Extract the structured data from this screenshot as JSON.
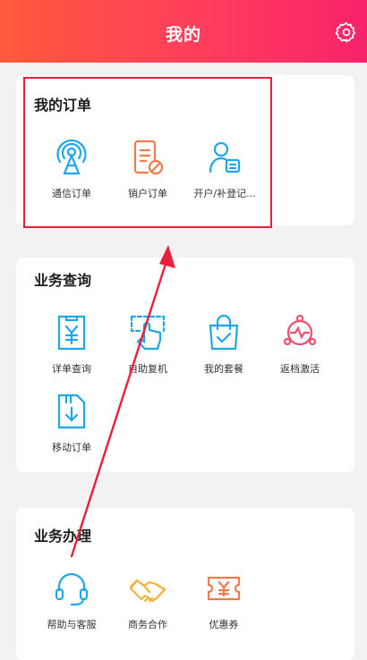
{
  "header": {
    "title": "我的",
    "settings_icon": "gear-icon",
    "gradient": [
      "#ff5a3c",
      "#f7236a"
    ]
  },
  "sections": {
    "orders": {
      "title": "我的订单",
      "items": [
        {
          "label": "通信订单",
          "icon": "antenna-icon"
        },
        {
          "label": "销户订单",
          "icon": "document-cancel-icon"
        },
        {
          "label": "开户/补登记...",
          "icon": "user-card-icon"
        }
      ]
    },
    "query": {
      "title": "业务查询",
      "items": [
        {
          "label": "详单查询",
          "icon": "yuan-bill-icon"
        },
        {
          "label": "自助复机",
          "icon": "touch-select-icon"
        },
        {
          "label": "我的套餐",
          "icon": "shopping-bag-check-icon"
        },
        {
          "label": "返档激活",
          "icon": "activation-icon"
        },
        {
          "label": "移动订单",
          "icon": "sim-download-icon"
        }
      ]
    },
    "handle": {
      "title": "业务办理",
      "items": [
        {
          "label": "帮助与客服",
          "icon": "headset-icon"
        },
        {
          "label": "商务合作",
          "icon": "handshake-icon"
        },
        {
          "label": "优惠券",
          "icon": "coupon-icon"
        }
      ]
    }
  },
  "colors": {
    "blue": "#1ea7e8",
    "orange": "#f07a4a",
    "red": "#e8203a",
    "pink": "#f0506e"
  }
}
